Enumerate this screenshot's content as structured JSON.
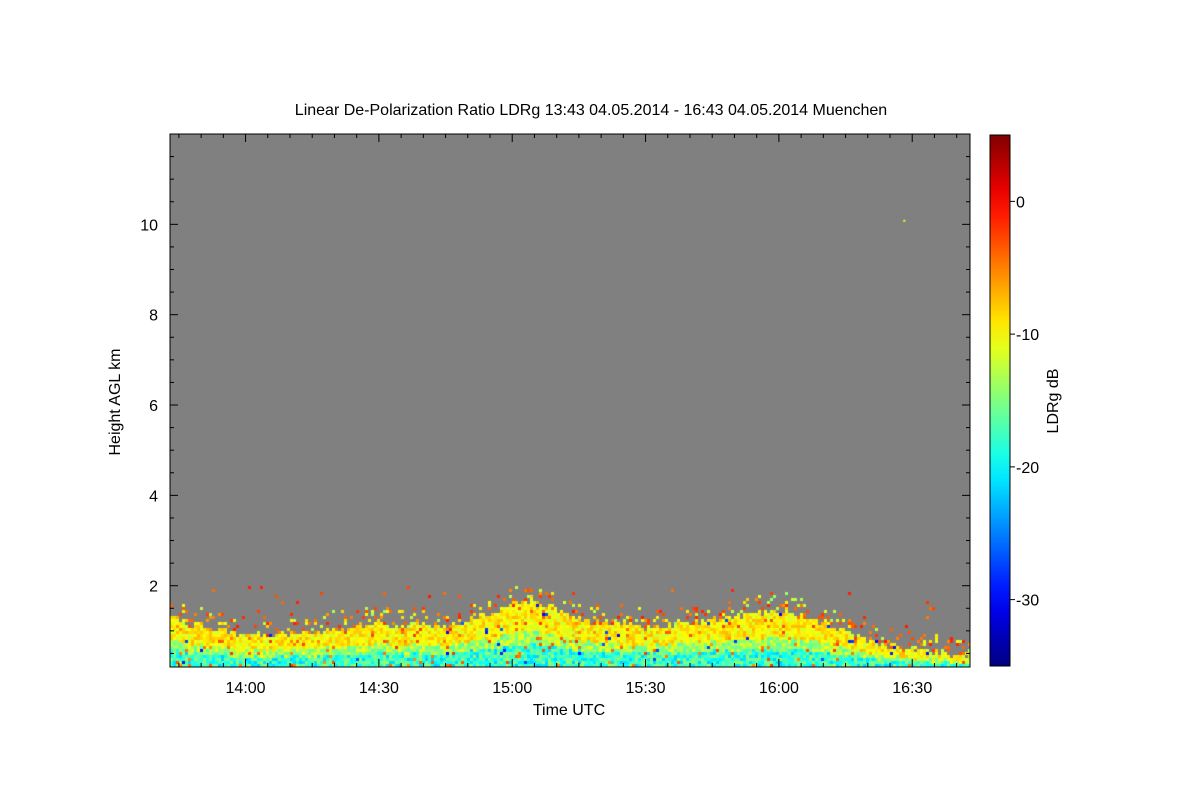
{
  "chart_data": {
    "type": "heatmap",
    "title": "Linear De-Polarization Ratio LDRg   13:43 04.05.2014 - 16:43 04.05.2014 Muenchen",
    "xlabel": "Time UTC",
    "ylabel": "Height AGL km",
    "x_unit": "UTC time",
    "xlim": [
      "13:43",
      "16:43"
    ],
    "x_ticks": [
      "14:00",
      "14:30",
      "15:00",
      "15:30",
      "16:00",
      "16:30"
    ],
    "y_unit": "km",
    "ylim": [
      0.2,
      12
    ],
    "y_ticks": [
      2,
      4,
      6,
      8,
      10
    ],
    "colorbar": {
      "label": "LDRg dB",
      "range": [
        -35,
        5
      ],
      "ticks": [
        0,
        -10,
        -20,
        -30
      ],
      "colormap": "jet",
      "colors": [
        "#00008f",
        "#0000ff",
        "#00ffff",
        "#ffff00",
        "#ff0000",
        "#800000"
      ]
    },
    "background_color": "#808080",
    "grid": false,
    "description_of_data": {
      "signal_top_profile_km": {
        "times": [
          "13:43",
          "14:00",
          "14:15",
          "14:30",
          "14:45",
          "15:00",
          "15:05",
          "15:15",
          "15:30",
          "15:45",
          "16:00",
          "16:10",
          "16:20",
          "16:30",
          "16:43"
        ],
        "top_km": [
          1.3,
          0.9,
          1.0,
          1.2,
          1.1,
          1.6,
          1.7,
          1.3,
          1.1,
          1.3,
          1.5,
          1.2,
          0.8,
          0.6,
          0.5
        ]
      },
      "isolated_point": {
        "time": "16:28",
        "height_km": 10.1,
        "value_db": -10
      }
    }
  }
}
